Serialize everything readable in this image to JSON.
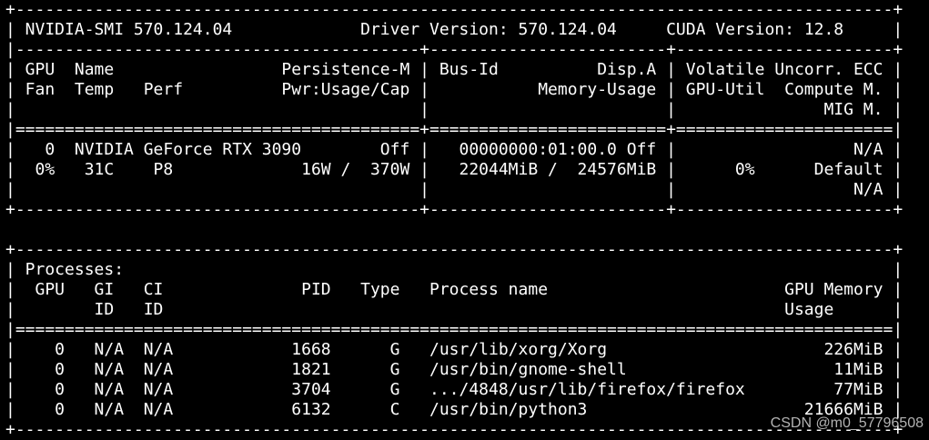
{
  "terminal": {
    "background": "#000000",
    "foreground": "#ffffff",
    "lines": [
      "+-----------------------------------------------------------------------------------------+",
      "| NVIDIA-SMI 570.124.04             Driver Version: 570.124.04     CUDA Version: 12.8     |",
      "|-----------------------------------------+------------------------+----------------------+",
      "| GPU  Name                 Persistence-M | Bus-Id          Disp.A | Volatile Uncorr. ECC |",
      "| Fan  Temp   Perf          Pwr:Usage/Cap |           Memory-Usage | GPU-Util  Compute M. |",
      "|                                         |                        |               MIG M. |",
      "|=========================================+========================+======================|",
      "|   0  NVIDIA GeForce RTX 3090        Off |   00000000:01:00.0 Off |                  N/A |",
      "|  0%   31C    P8             16W /  370W |   22044MiB /  24576MiB |      0%      Default |",
      "|                                         |                        |                  N/A |",
      "+-----------------------------------------+------------------------+----------------------+",
      "",
      "+-----------------------------------------------------------------------------------------+",
      "| Processes:                                                                              |",
      "|  GPU   GI   CI              PID   Type   Process name                        GPU Memory |",
      "|        ID   ID                                                               Usage      |",
      "|=========================================================================================|",
      "|    0   N/A  N/A            1668      G   /usr/lib/xorg/Xorg                      226MiB |",
      "|    0   N/A  N/A            1821      G   /usr/bin/gnome-shell                     11MiB |",
      "|    0   N/A  N/A            3704      G   .../4848/usr/lib/firefox/firefox         77MiB |",
      "|    0   N/A  N/A            6132      C   /usr/bin/python3                      21666MiB |",
      "+-----------------------------------------------------------------------------------------+"
    ]
  },
  "watermark": "CSDN @m0_57796508"
}
